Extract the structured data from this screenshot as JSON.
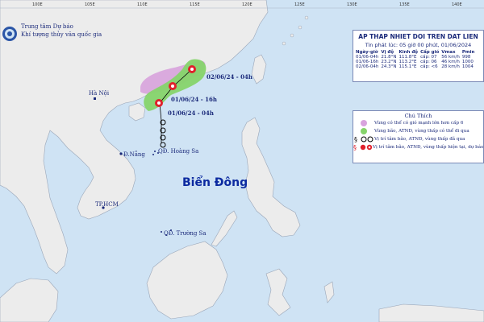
{
  "header": {
    "org_line1": "Trung tâm Dự báo",
    "org_line2": "Khí tượng thủy văn quốc gia"
  },
  "axes": {
    "longitudes": [
      "100E",
      "105E",
      "110E",
      "115E",
      "120E",
      "125E",
      "130E",
      "135E",
      "140E"
    ]
  },
  "places": {
    "hanoi": "Hà Nội",
    "danang": "Đ.Nẵng",
    "hcm": "TP.HCM",
    "hoangsa": "QĐ. Hoàng Sa",
    "truongsa": "QĐ. Trường Sa",
    "sea": "Biển Đông"
  },
  "track_labels": {
    "t1": "02/06/24 - 04h",
    "t2": "01/06/24 - 16h",
    "t3": "01/06/24 - 04h"
  },
  "info": {
    "title": "AP THAP NHIET DOI TREN DAT LIEN",
    "issued": "Tin phát lúc: 05 giờ 00 phút, 01/06/2024",
    "columns": [
      "Ngày-giờ",
      "Vị độ",
      "Kinh độ",
      "Cấp gió",
      "Vmax",
      "Pmin"
    ],
    "rows": [
      [
        "01/06-04h",
        "21.8°N",
        "111.8°E",
        "cấp: 07",
        "56 km/h",
        "998"
      ],
      [
        "01/06-16h",
        "23.2°N",
        "113.2°E",
        "cấp: 06",
        "46 km/h",
        "1000"
      ],
      [
        "02/06-04h",
        "24.3°N",
        "115.1°E",
        "cấp: <6",
        "28 km/h",
        "1004"
      ]
    ]
  },
  "legend": {
    "title": "Chú Thích",
    "items": [
      "Vùng có thể có gió mạnh lớn hơn cấp 6",
      "Vùng bão, ATNĐ, vùng thấp có thể đi qua",
      "Vị trí tâm bão, ATNĐ, vùng thấp đã qua",
      "Vị trí tâm bão, ATNĐ, vùng thấp hiện tại, dự báo"
    ]
  },
  "colors": {
    "ocean": "#cfe3f4",
    "land": "#ececec",
    "wind_zone": "#d8a3dd",
    "cone": "#86d46a",
    "storm_red": "#e0202b"
  }
}
